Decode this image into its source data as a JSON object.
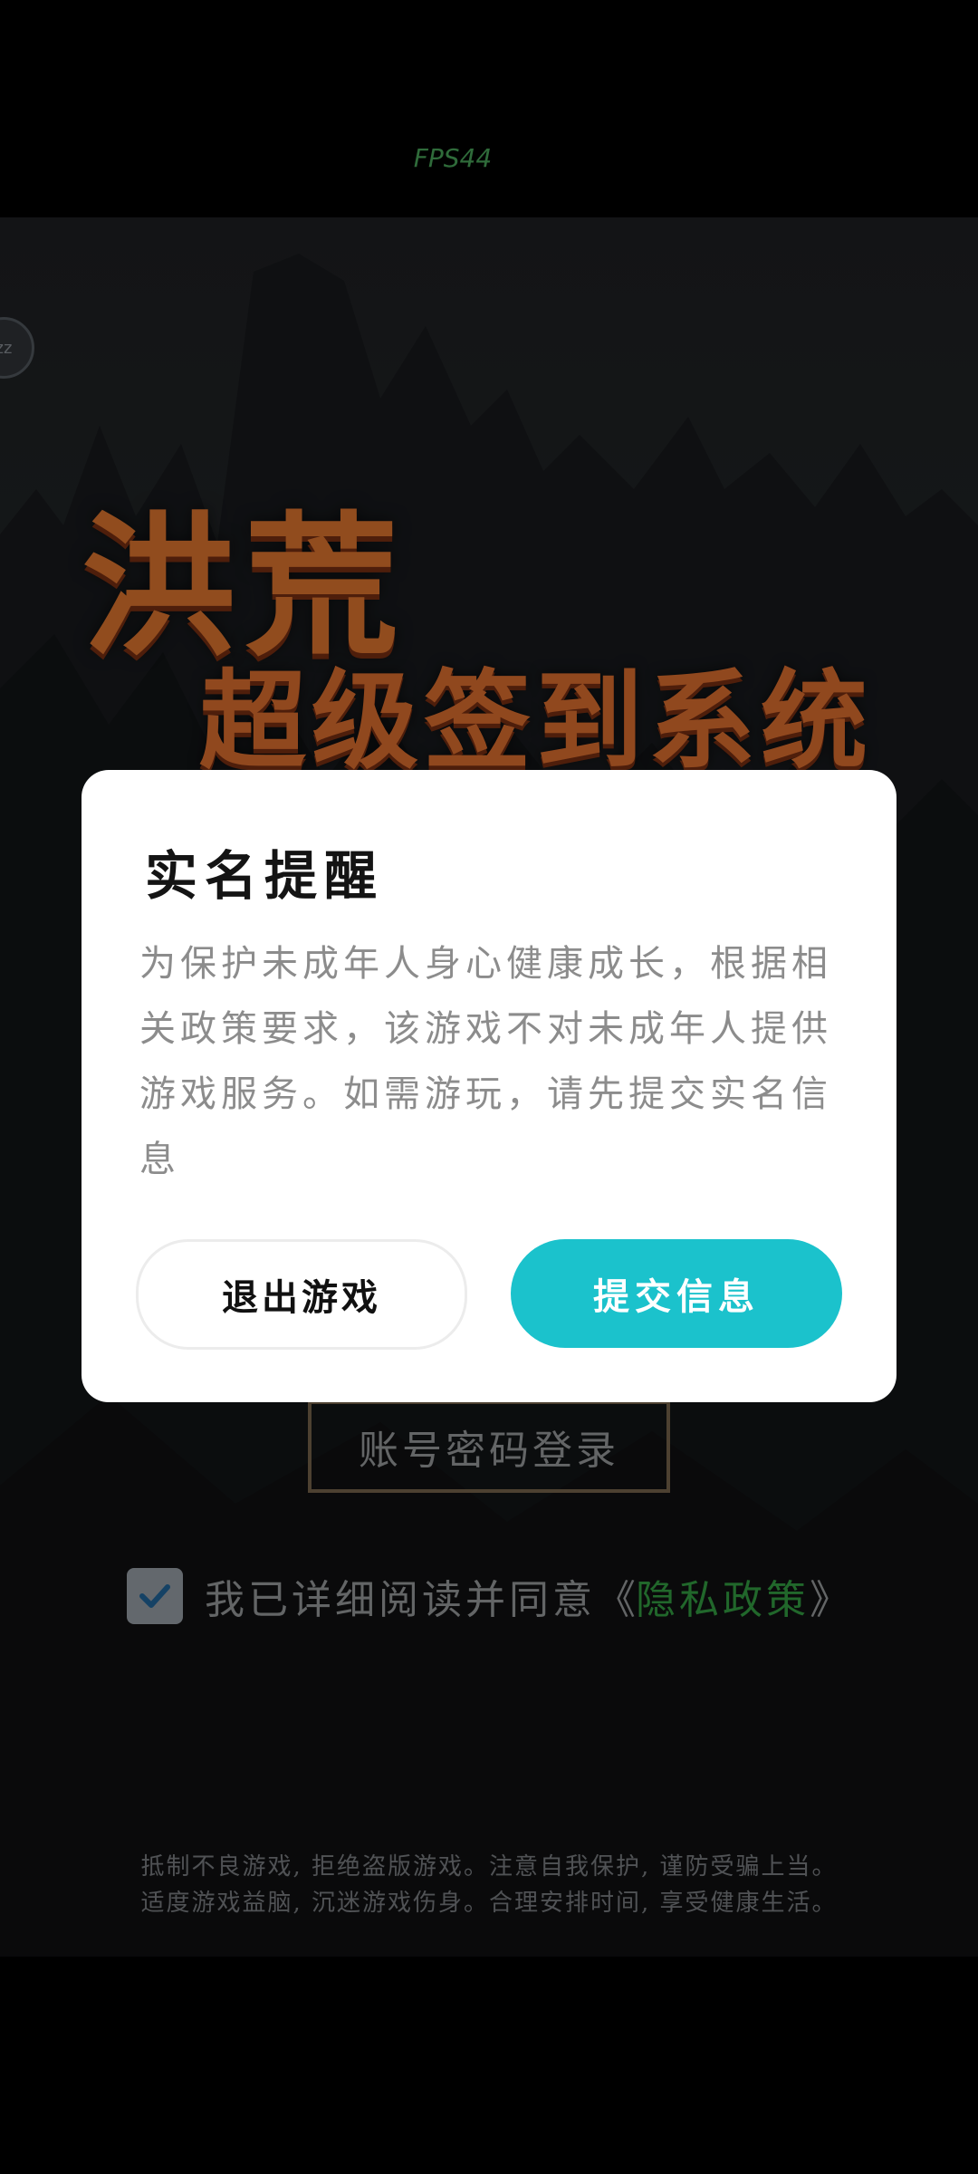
{
  "status": {
    "fps": "FPS44"
  },
  "game": {
    "title_line1": "洪荒",
    "title_line2": "超级签到系统",
    "corner_badge": "zz",
    "account_login": "账号密码登录",
    "agree_text": "我已详细阅读并同意",
    "bracket_open": "《",
    "policy_link": "隐私政策",
    "bracket_close": "》",
    "footer_line1": "抵制不良游戏, 拒绝盗版游戏。注意自我保护, 谨防受骗上当。",
    "footer_line2": "适度游戏益脑, 沉迷游戏伤身。合理安排时间, 享受健康生活。",
    "checkbox_checked": true
  },
  "dialog": {
    "title": "实名提醒",
    "body": "为保护未成年人身心健康成长，根据相关政策要求，该游戏不对未成年人提供游戏服务。如需游玩，请先提交实名信息",
    "exit_label": "退出游戏",
    "submit_label": "提交信息",
    "accent_color": "#1bc2cc"
  }
}
